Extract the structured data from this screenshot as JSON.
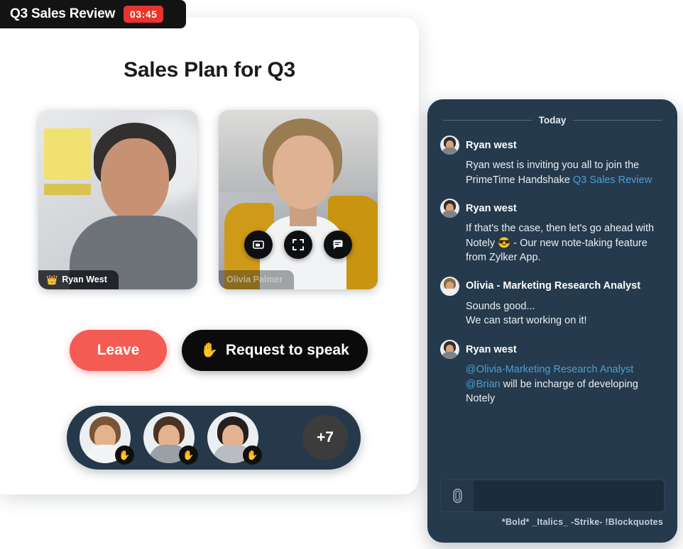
{
  "meeting": {
    "title": "Q3 Sales Review",
    "timer": "03:45",
    "page_title": "Sales Plan for Q3"
  },
  "tiles": [
    {
      "name": "Ryan West",
      "crown_icon": "crown-icon",
      "is_host": true
    },
    {
      "name": "Olivia Palmer",
      "is_host": false
    }
  ],
  "tile_actions": [
    {
      "name": "screen-share-icon"
    },
    {
      "name": "fullscreen-icon"
    },
    {
      "name": "chat-bubble-icon"
    }
  ],
  "controls": {
    "leave_label": "Leave",
    "speak_label": "Request to speak",
    "speak_icon": "raised-hand-icon"
  },
  "participants": {
    "hand_icon": "raised-hand-icon",
    "overflow_label": "+7",
    "avatars": [
      {
        "name": "participant-1",
        "raised_hand": true
      },
      {
        "name": "participant-2",
        "raised_hand": true
      },
      {
        "name": "participant-3",
        "raised_hand": true
      }
    ]
  },
  "chat": {
    "day_label": "Today",
    "messages": [
      {
        "author": "Ryan west",
        "avatar": "ryan",
        "text_before": "Ryan west is inviting you all to join the PrimeTime Handshake ",
        "link": "Q3 Sales Review",
        "text_after": ""
      },
      {
        "author": "Ryan west",
        "avatar": "ryan",
        "text_before": "If that's the case, then let's go ahead with Notely 😎  - Our new note-taking feature from Zylker App.",
        "link": "",
        "text_after": ""
      },
      {
        "author": "Olivia - Marketing Research Analyst",
        "avatar": "olivia",
        "text_before": "Sounds good...\nWe can start working on it!",
        "link": "",
        "text_after": ""
      },
      {
        "author": "Ryan west",
        "avatar": "ryan",
        "text_before": "",
        "link": "@Olivia-Marketing Research Analyst @Brian",
        "text_after": " will be incharge of developing Notely"
      }
    ],
    "composer": {
      "placeholder": "",
      "value": "",
      "attach_icon": "paperclip-icon"
    },
    "format_hints": "*Bold* _Italics_ -Strike- !Blockquotes"
  },
  "colors": {
    "accent_red": "#e8342a",
    "leave_red": "#f45b53",
    "panel_navy": "#253a4c",
    "link_blue": "#4a9fd8"
  }
}
